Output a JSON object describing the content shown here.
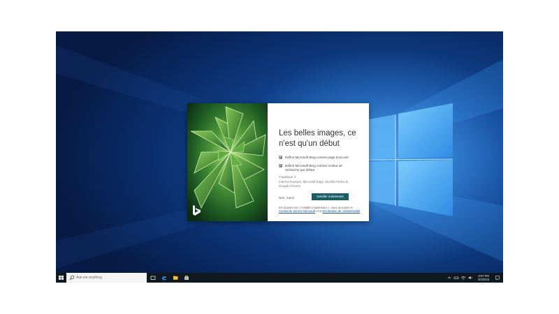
{
  "dialog": {
    "title": "Les belles images, ce n'est qu'un début",
    "options": [
      {
        "label": "Définir Microsoft Bing comme page d'accueil",
        "checked": true
      },
      {
        "label": "Définir Microsoft Bing comme moteur de recherche par défaut",
        "checked": true
      }
    ],
    "applies_to": "S'applique à :",
    "browsers": "Internet Explorer, Microsoft Edge, Mozilla Firefox & Google Chrome",
    "decline_label": "Non, merci",
    "install_label": "Installer maintenant",
    "legal_prefix": "En cliquant sur « Installer maintenant », vous acceptez le",
    "legal_link1": "Contrat de service Microsoft",
    "legal_mid": "et la",
    "legal_link2": "Déclaration de confidentialité",
    "accent_color": "#1b5f66"
  },
  "taskbar": {
    "search_placeholder": "Ask me anything",
    "clock_time": "3:07 PM",
    "clock_date": "4/2/2015",
    "icons": [
      "windows-start-icon",
      "search-icon",
      "task-view-icon",
      "edge-browser-icon",
      "file-explorer-icon",
      "store-icon"
    ],
    "tray_icons": [
      "chevron-up-icon",
      "battery-icon",
      "network-icon",
      "volume-icon",
      "keyboard-icon",
      "notifications-icon"
    ]
  }
}
